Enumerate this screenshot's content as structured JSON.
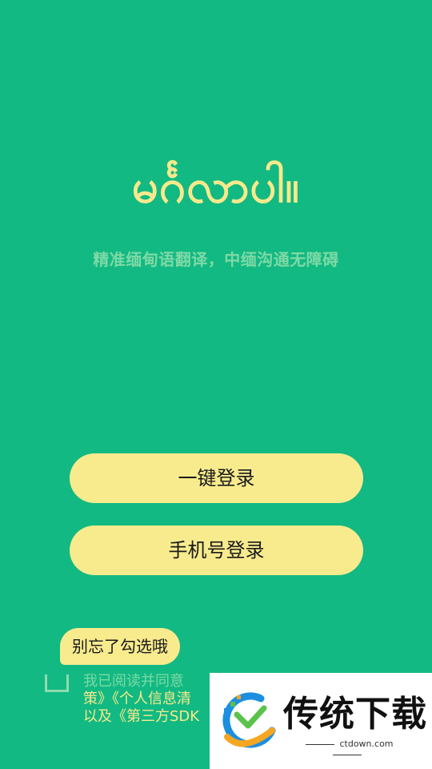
{
  "logo": {
    "text": "မင်္ဂလာပါ။"
  },
  "tagline": "精准缅甸语翻译，中缅沟通无障碍",
  "buttons": {
    "one_key_login": "一键登录",
    "phone_login": "手机号登录"
  },
  "agreement": {
    "tooltip": "别忘了勾选哦",
    "line1": "我已阅读并同意",
    "line2": "策》《个人信息清",
    "line3": "以及《第三方SDK"
  },
  "watermark": {
    "text": "传统下载",
    "url": "ctdown.com"
  },
  "colors": {
    "background": "#12b982",
    "button": "#f8eb8e",
    "logo": "#f8e98c",
    "muted_text": "#7ed9a6"
  }
}
